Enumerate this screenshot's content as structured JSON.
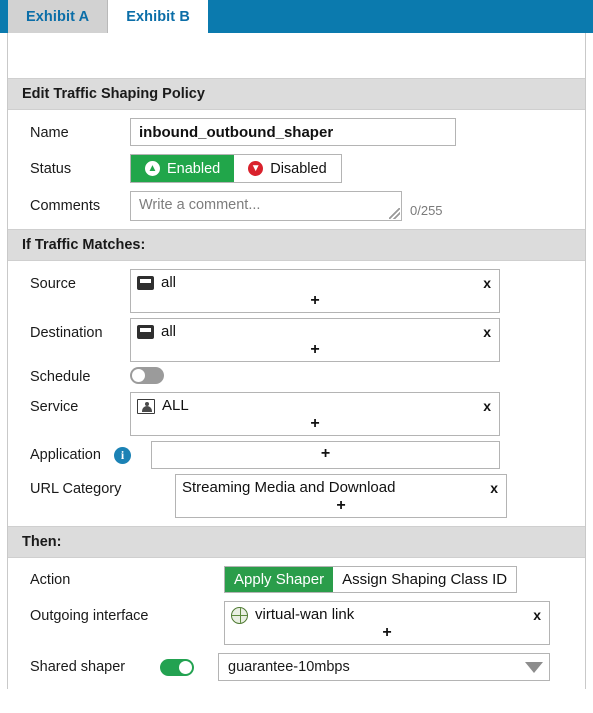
{
  "tabs": [
    {
      "label": "Exhibit A",
      "active": false
    },
    {
      "label": "Exhibit B",
      "active": true
    }
  ],
  "sections": {
    "edit_policy": "Edit Traffic Shaping Policy",
    "if_traffic_matches": "If Traffic Matches:",
    "then": "Then:"
  },
  "form": {
    "name": {
      "label": "Name",
      "value": "inbound_outbound_shaper"
    },
    "status": {
      "label": "Status",
      "enabled_label": "Enabled",
      "disabled_label": "Disabled",
      "selected": "Enabled",
      "enabled_icon": "arrow-up-circle-icon",
      "disabled_icon": "arrow-down-circle-icon"
    },
    "comments": {
      "label": "Comments",
      "placeholder": "Write a comment...",
      "value": "",
      "counter": "0/255"
    },
    "source": {
      "label": "Source",
      "items": [
        {
          "icon": "address-object-icon",
          "text": "all"
        }
      ],
      "add_label": "+",
      "remove_label": "x"
    },
    "destination": {
      "label": "Destination",
      "items": [
        {
          "icon": "address-object-icon",
          "text": "all"
        }
      ],
      "add_label": "+",
      "remove_label": "x"
    },
    "schedule": {
      "label": "Schedule",
      "toggle_state": "off"
    },
    "service": {
      "label": "Service",
      "items": [
        {
          "icon": "service-object-icon",
          "text": "ALL"
        }
      ],
      "add_label": "+",
      "remove_label": "x"
    },
    "application": {
      "label": "Application",
      "info_icon": "info-icon",
      "items": [],
      "add_label": "+"
    },
    "url_category": {
      "label": "URL Category",
      "items": [
        {
          "icon": "",
          "text": "Streaming Media and Download"
        }
      ],
      "add_label": "+",
      "remove_label": "x"
    },
    "action": {
      "label": "Action",
      "apply_shaper_label": "Apply Shaper",
      "assign_class_label": "Assign Shaping Class ID",
      "selected": "Apply Shaper"
    },
    "outgoing_interface": {
      "label": "Outgoing interface",
      "items": [
        {
          "icon": "globe-icon",
          "text": "virtual-wan link"
        }
      ],
      "add_label": "+",
      "remove_label": "x"
    },
    "shared_shaper": {
      "label": "Shared shaper",
      "toggle_state": "on",
      "selected_option": "guarantee-10mbps",
      "caret_icon": "chevron-down-icon"
    }
  },
  "colors": {
    "tab_bar": "#0b7aae",
    "tab_text": "#0b6ea8",
    "tab_inactive_bg": "#d2d2d2",
    "section_header_bg": "#dcdcdc",
    "green": "#21a64a",
    "green_action": "#2a9d4a",
    "red": "#d9212c",
    "info_blue": "#1b82b5",
    "toggle_on": "#23a251",
    "toggle_off": "#9b9b9b"
  }
}
